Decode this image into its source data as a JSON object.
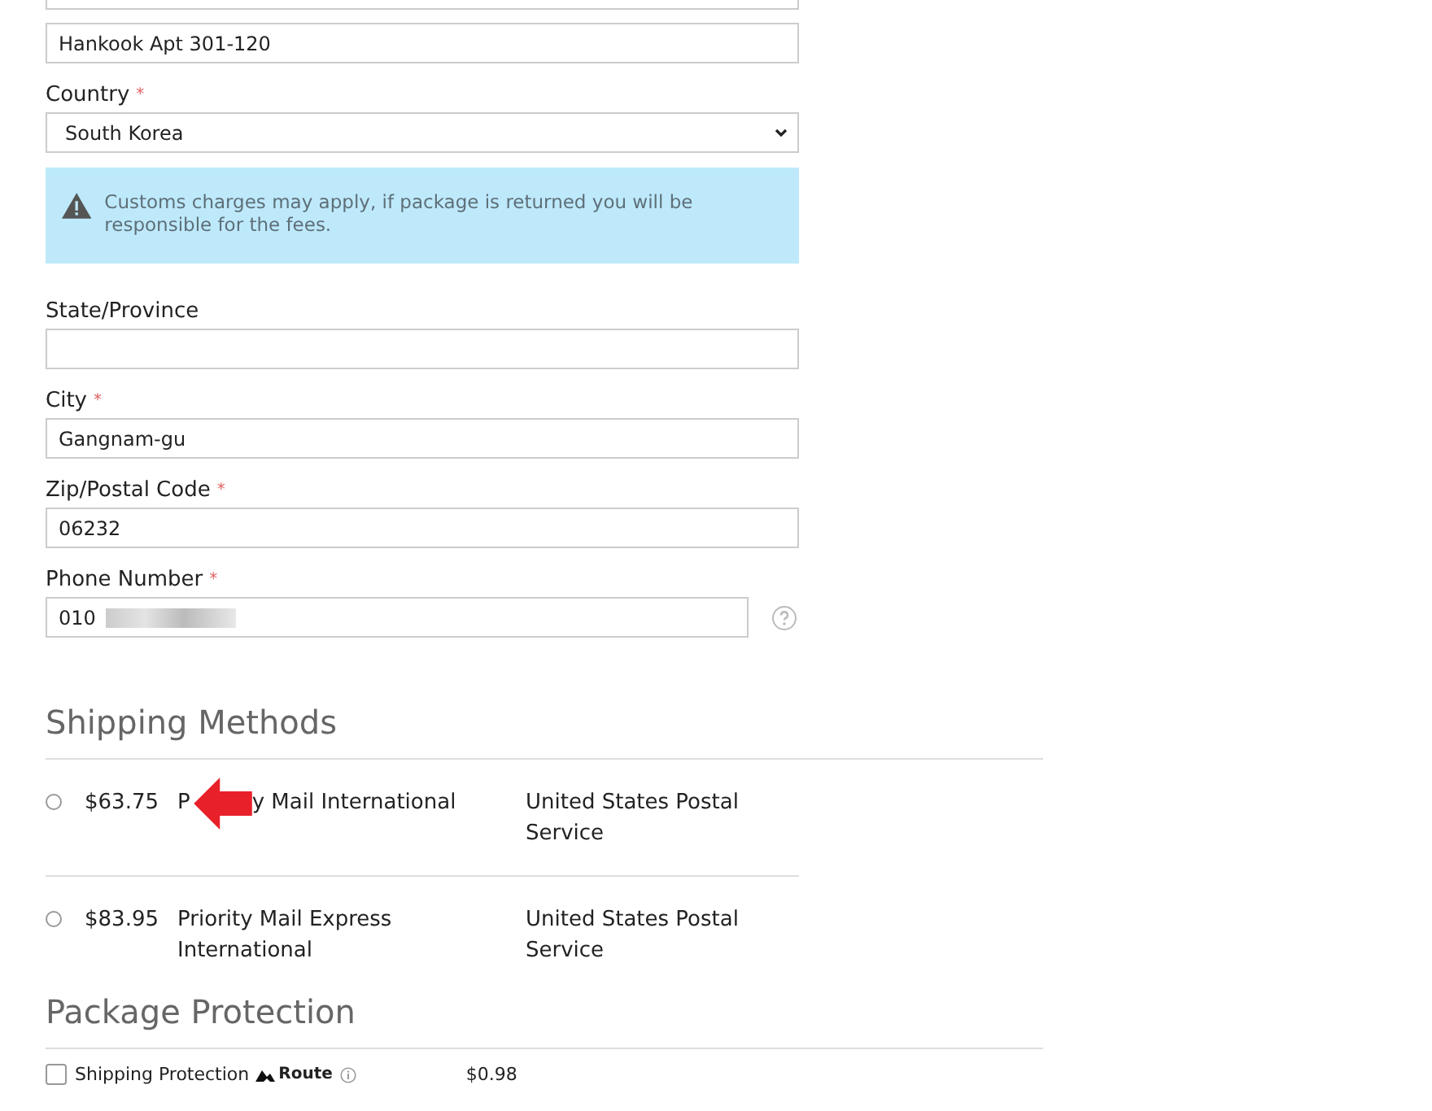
{
  "address_line_2": {
    "value": "Hankook Apt 301-120"
  },
  "country": {
    "label": "Country",
    "required_mark": "*",
    "value": "South Korea"
  },
  "customs_notice": "Customs charges may apply, if package is returned you will be responsible for the fees.",
  "fields": [
    {
      "label": "State/Province"
    },
    {
      "label": "City",
      "required_mark": "*",
      "value": "Gangnam-gu"
    },
    {
      "label": "Zip/Postal Code",
      "required_mark": "*",
      "value": "06232"
    }
  ],
  "phone": {
    "label": "Phone Number",
    "required_mark": "*",
    "value": "010"
  },
  "shipping_methods": {
    "title": "Shipping Methods",
    "options": [
      {
        "price": "$63.75",
        "name_parts": [
          "P",
          "y Mail International"
        ],
        "carrier": "United States Postal Service",
        "selected": false
      },
      {
        "price": "$83.95",
        "name_parts": [
          "Priority Mail Express International"
        ],
        "carrier": "United States Postal Service",
        "selected": false
      }
    ]
  },
  "package_protection": {
    "title": "Package Protection",
    "label": "Shipping Protection",
    "brand": "Route",
    "price": "$0.98",
    "checked": false
  }
}
